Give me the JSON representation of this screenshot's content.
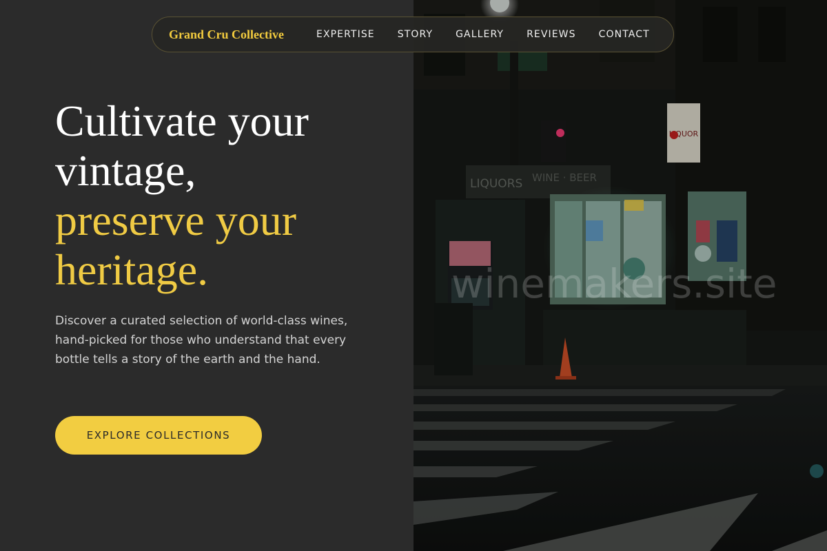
{
  "brand": "Grand Cru Collective",
  "nav": {
    "links": [
      "EXPERTISE",
      "STORY",
      "GALLERY",
      "REVIEWS",
      "CONTACT"
    ]
  },
  "hero": {
    "title_line1": "Cultivate your",
    "title_line2": "vintage,",
    "title_accent_line1": "preserve your",
    "title_accent_line2": "heritage.",
    "description": "Discover a curated selection of world-class wines, hand-picked for those who understand that every bottle tells a story of the earth and the hand.",
    "cta_label": "EXPLORE COLLECTIONS"
  },
  "photo": {
    "sign_liquor": "LIQUOR",
    "sign_liquors": "LIQUORS",
    "sign_beer": "WINE · BEER"
  },
  "watermark": "winemakers.site",
  "colors": {
    "accent": "#f2cd41",
    "panel_background": "#2b2b2b",
    "text_light": "#d4d4d4"
  }
}
